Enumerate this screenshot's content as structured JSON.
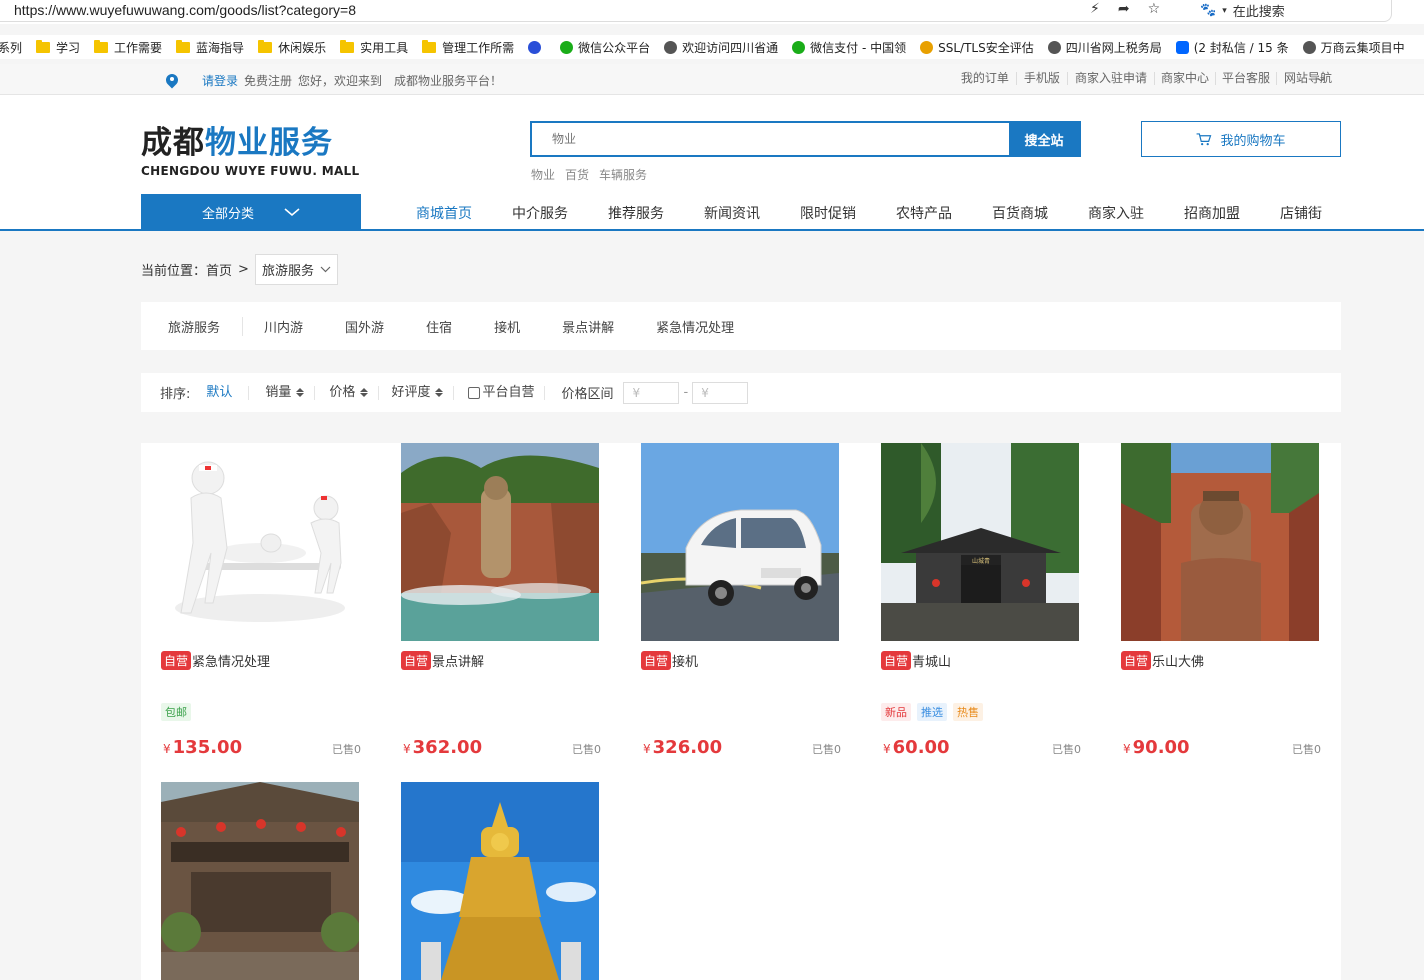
{
  "browser": {
    "url": "https://www.wuyefuwuwang.com/goods/list?category=8",
    "search_placeholder": "在此搜索"
  },
  "bookmarks": [
    {
      "label": "系列",
      "icon": "none"
    },
    {
      "label": "学习",
      "icon": "folder-icon"
    },
    {
      "label": "工作需要",
      "icon": "folder-icon"
    },
    {
      "label": "蓝海指导",
      "icon": "folder-icon"
    },
    {
      "label": "休闲娱乐",
      "icon": "folder-icon"
    },
    {
      "label": "实用工具",
      "icon": "folder-icon"
    },
    {
      "label": "管理工作所需",
      "icon": "folder-icon"
    },
    {
      "label": "",
      "icon": "paw-icon"
    },
    {
      "label": "微信公众平台",
      "icon": "wechat-mp-icon"
    },
    {
      "label": "欢迎访问四川省通",
      "icon": "globe-icon"
    },
    {
      "label": "微信支付 - 中国领",
      "icon": "wechat-pay-icon"
    },
    {
      "label": "SSL/TLS安全评估",
      "icon": "lock-icon"
    },
    {
      "label": "四川省网上税务局",
      "icon": "globe-icon"
    },
    {
      "label": "(2 封私信 / 15 条",
      "icon": "zhihu-icon"
    },
    {
      "label": "万商云集项目中",
      "icon": "globe-icon"
    }
  ],
  "topbar": {
    "login": "请登录",
    "register": "免费注册",
    "welcome": "您好，欢迎来到　成都物业服务平台！",
    "links": [
      "我的订单",
      "手机版",
      "商家入驻申请",
      "商家中心",
      "平台客服",
      "网站导航"
    ]
  },
  "header": {
    "logo_part1": "成都",
    "logo_part2": "物业服务",
    "logo_en": "CHENGDOU WUYE FUWU. MALL",
    "search_placeholder": "物业",
    "search_button": "搜全站",
    "hot_words": [
      "物业",
      "百货",
      "车辆服务"
    ],
    "cart_label": "我的购物车",
    "all_categories": "全部分类",
    "nav": [
      "商城首页",
      "中介服务",
      "推荐服务",
      "新闻资讯",
      "限时促销",
      "农特产品",
      "百货商城",
      "商家入驻",
      "招商加盟",
      "店铺街"
    ]
  },
  "breadcrumb": {
    "label": "当前位置：",
    "home": "首页",
    "separator": ">",
    "current": "旅游服务"
  },
  "subcategories": [
    "旅游服务",
    "川内游",
    "国外游",
    "住宿",
    "接机",
    "景点讲解",
    "紧急情况处理"
  ],
  "sort": {
    "label": "排序:",
    "default": "默认",
    "sales": "销量",
    "price": "价格",
    "rating": "好评度",
    "self_run": "平台自营",
    "price_range": "价格区间",
    "min_placeholder": "¥",
    "max_placeholder": "¥",
    "dash": "-"
  },
  "products": [
    {
      "badge": "自营",
      "title": "紧急情况处理",
      "tags": [
        {
          "text": "包邮",
          "color": "green"
        }
      ],
      "currency": "¥",
      "price": "135.00",
      "sold": "已售0",
      "image": "stretcher-illustration"
    },
    {
      "badge": "自营",
      "title": "景点讲解",
      "tags": [],
      "currency": "¥",
      "price": "362.00",
      "sold": "已售0",
      "image": "leshan-buddha-photo"
    },
    {
      "badge": "自营",
      "title": "接机",
      "tags": [],
      "currency": "¥",
      "price": "326.00",
      "sold": "已售0",
      "image": "white-van-photo"
    },
    {
      "badge": "自营",
      "title": "青城山",
      "tags": [
        {
          "text": "新品",
          "color": "red"
        },
        {
          "text": "推选",
          "color": "blue"
        },
        {
          "text": "热售",
          "color": "orange"
        }
      ],
      "currency": "¥",
      "price": "60.00",
      "sold": "已售0",
      "image": "qingcheng-gate-photo"
    },
    {
      "badge": "自营",
      "title": "乐山大佛",
      "tags": [],
      "currency": "¥",
      "price": "90.00",
      "sold": "已售0",
      "image": "giant-buddha-photo"
    },
    {
      "badge": "",
      "title": "",
      "tags": [],
      "currency": "",
      "price": "",
      "sold": "",
      "image": "ancient-building-photo"
    },
    {
      "badge": "",
      "title": "",
      "tags": [],
      "currency": "",
      "price": "",
      "sold": "",
      "image": "golden-buddha-photo"
    }
  ],
  "colors": {
    "brand": "#1a78c2",
    "price": "#e4393c",
    "page_bg": "#f5f5f5"
  }
}
